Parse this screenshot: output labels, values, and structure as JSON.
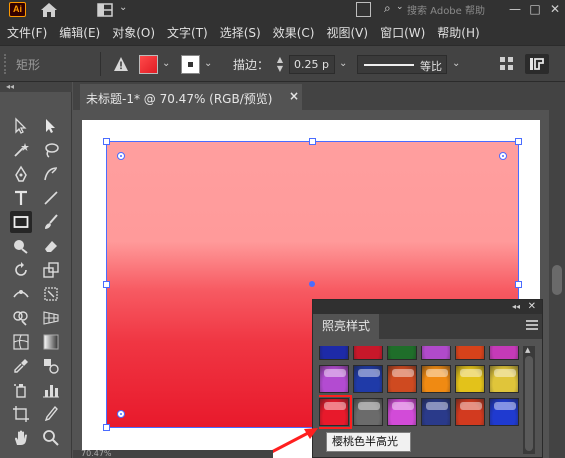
{
  "title_bar": {
    "app_logo": "Ai",
    "search_placeholder": "搜索 Adobe 帮助",
    "window_controls": [
      "—",
      "□",
      "✕"
    ]
  },
  "menu": {
    "items": [
      "文件(F)",
      "编辑(E)",
      "对象(O)",
      "文字(T)",
      "选择(S)",
      "效果(C)",
      "视图(V)",
      "窗口(W)",
      "帮助(H)"
    ]
  },
  "control_bar": {
    "selection_label": "矩形",
    "fill_color": "#e8192b",
    "stroke_label": "描边：",
    "stroke_weight": "0.25 p",
    "stroke_profile": "等比"
  },
  "tab": {
    "document_title": "未标题-1* @ 70.47% (RGB/预览)",
    "close_label": "×"
  },
  "panel": {
    "title": "照亮样式",
    "swatches": [
      [
        "#1d2aa8",
        "#c8182a",
        "#1f6e2a",
        "#b04acb",
        "#d6421a",
        "#c53ab8"
      ],
      [
        "#b34bd1",
        "#1f3aa8",
        "#cf4a20",
        "#f08a12",
        "#e3c21a",
        "#e0c53a"
      ],
      [
        "#e8192b",
        "#6b6b6b",
        "#d24bd8",
        "#2a3a8a",
        "#d23a1f",
        "#1f3ad0"
      ]
    ],
    "selected_swatch": {
      "row": 2,
      "col": 0
    }
  },
  "tooltip": {
    "text": "樱桃色半高光"
  },
  "status": {
    "zoom": "70.47%"
  }
}
